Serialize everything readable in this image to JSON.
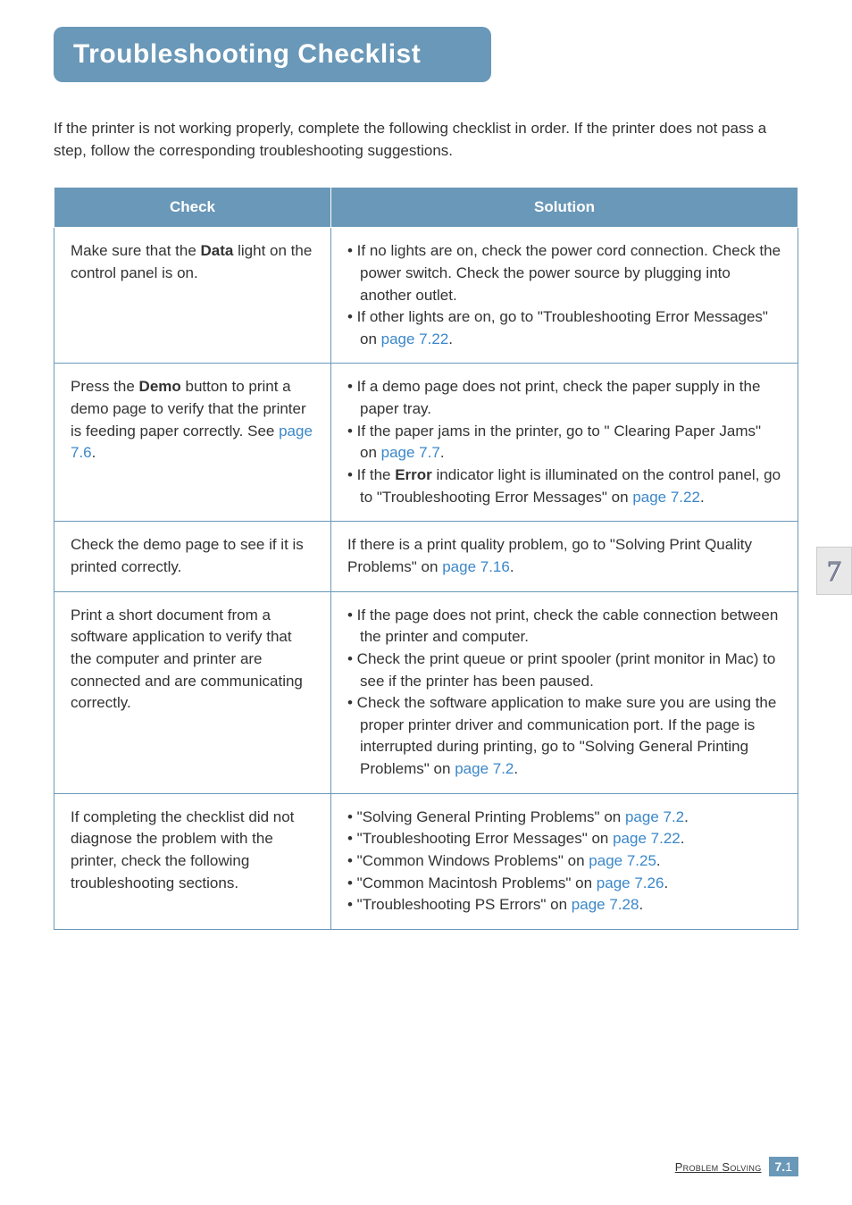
{
  "title": "Troubleshooting Checklist",
  "intro": "If the printer is not working properly, complete the following checklist in order. If the printer does not pass a step, follow the corresponding troubleshooting suggestions.",
  "headers": {
    "check": "Check",
    "solution": "Solution"
  },
  "rows": [
    {
      "check_pre": "Make sure that the ",
      "check_bold": "Data",
      "check_post": " light on the control panel is on.",
      "sol_l1a": "• If no lights are on, check the power cord connection. Check the power switch. Check the power source by plugging into another outlet.",
      "sol_l2a": "• If other lights are on, go to \"Troubleshooting Error Messages\" on ",
      "sol_l2link": "page 7.22",
      "sol_l2b": "."
    },
    {
      "check_pre": "Press the ",
      "check_bold": "Demo",
      "check_post": " button to print a demo page to verify that the printer is feeding paper correctly. See ",
      "check_link": "page 7.6",
      "check_end": ".",
      "sol_l1": "• If a demo page does not print, check the paper supply in the paper tray.",
      "sol_l2a": "• If the paper jams in the printer, go to \" Clearing Paper Jams\" on ",
      "sol_l2link": "page 7.7",
      "sol_l2b": ".",
      "sol_l3a": "• If the ",
      "sol_l3bold": "Error",
      "sol_l3b": " indicator light is illuminated on the control panel, go to \"Troubleshooting Error Messages\" on ",
      "sol_l3link": "page 7.22",
      "sol_l3c": "."
    },
    {
      "check": "Check the demo page to see if it is printed correctly.",
      "sol_a": "If there is a print quality problem, go to \"Solving Print Quality Problems\" on ",
      "sol_link": "page 7.16",
      "sol_b": "."
    },
    {
      "check": "Print a short document from a software application to verify that the computer and printer are connected and are communicating correctly.",
      "sol_l1": "• If the page does not print, check the cable connection between the printer and computer.",
      "sol_l2": "• Check the print queue or print spooler (print monitor in Mac) to see if the printer has been paused.",
      "sol_l3a": "• Check the software application to make sure you are using the proper printer driver and communication port. If the page is interrupted during printing, go to \"Solving General Printing Problems\" on ",
      "sol_l3link": "page 7.2",
      "sol_l3b": "."
    },
    {
      "check": "If completing the checklist did not diagnose the problem with the printer, check the following troubleshooting sections.",
      "sol_l1a": "• \"Solving General Printing Problems\" on ",
      "sol_l1link": "page 7.2",
      "sol_l1b": ".",
      "sol_l2a": "• \"Troubleshooting Error Messages\" on ",
      "sol_l2link": "page 7.22",
      "sol_l2b": ".",
      "sol_l3a": "• \"Common Windows Problems\" on ",
      "sol_l3link": "page 7.25",
      "sol_l3b": ".",
      "sol_l4a": "• \"Common Macintosh Problems\" on ",
      "sol_l4link": "page 7.26",
      "sol_l4b": ".",
      "sol_l5a": "• \"Troubleshooting PS Errors\" on ",
      "sol_l5link": "page 7.28",
      "sol_l5b": "."
    }
  ],
  "chapter_number": "7",
  "footer_section": "Problem Solving",
  "footer_page_major": "7.",
  "footer_page_minor": "1"
}
